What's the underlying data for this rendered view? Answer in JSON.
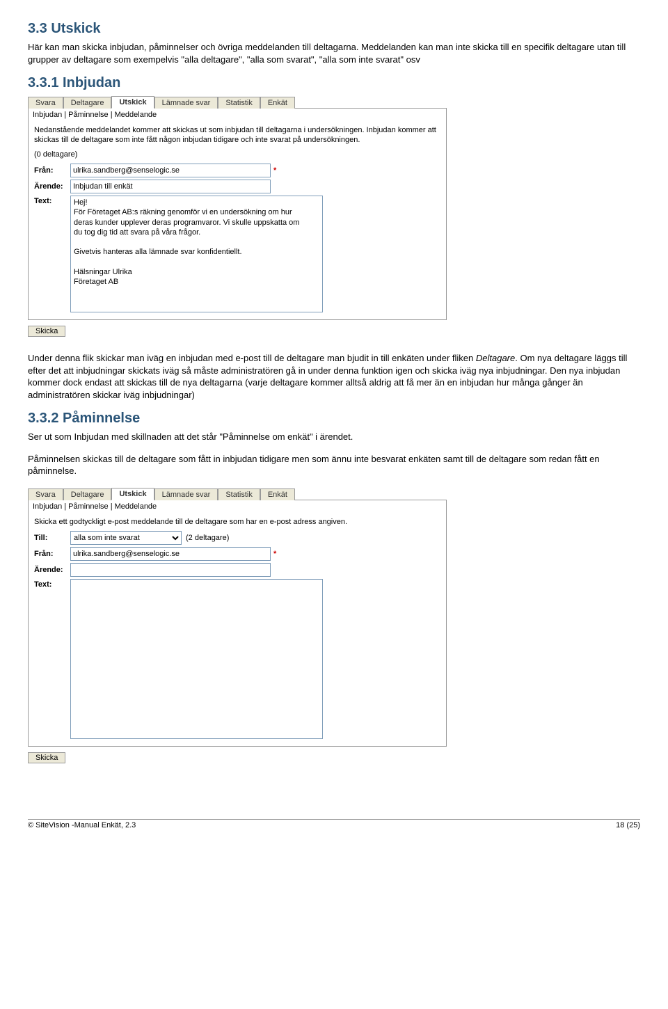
{
  "section1": {
    "title": "3.3 Utskick",
    "para1": "Här kan man skicka inbjudan, påminnelser och övriga meddelanden till deltagarna. Meddelanden kan man inte skicka till en specifik deltagare utan till grupper av deltagare som exempelvis \"alla deltagare\", \"alla som svarat\", \"alla som inte svarat\" osv"
  },
  "section2": {
    "title": "3.3.1 Inbjudan",
    "after": "Under denna flik skickar man iväg en inbjudan med e-post till de deltagare man bjudit in till enkäten under fliken ",
    "after_italic": "Deltagare",
    "after2": ". Om nya deltagare läggs till efter det att inbjudningar skickats iväg så måste administratören gå in under denna funktion igen och skicka iväg nya inbjudningar. Den nya inbjudan kommer dock endast att skickas till de nya deltagarna (varje deltagare kommer alltså aldrig att få mer än en inbjudan hur många gånger än administratören skickar iväg inbjudningar)"
  },
  "section3": {
    "title": "3.3.2 Påminnelse",
    "para1": "Ser ut som Inbjudan med skillnaden att det står \"Påminnelse om enkät\" i ärendet.",
    "para2": "Påminnelsen skickas till de deltagare som fått in inbjudan tidigare men som ännu inte besvarat enkäten samt till de deltagare som redan fått en påminnelse."
  },
  "tabs": [
    "Svara",
    "Deltagare",
    "Utskick",
    "Lämnade svar",
    "Statistik",
    "Enkät"
  ],
  "subtabs": "Inbjudan | Påminnelse | Meddelande",
  "panel1": {
    "info": "Nedanstående meddelandet kommer att skickas ut som inbjudan till deltagarna i undersökningen. Inbjudan kommer att skickas till de deltagare som inte fått någon inbjudan tidigare och inte svarat på undersökningen.",
    "count": "(0 deltagare)",
    "fran_label": "Från:",
    "fran_value": "ulrika.sandberg@senselogic.se",
    "arende_label": "Ärende:",
    "arende_value": "Inbjudan till enkät",
    "text_label": "Text:",
    "textarea": "Hej!\nFör Företaget AB:s räkning genomför vi en undersökning om hur deras kunder upplever deras programvaror. Vi skulle uppskatta om du tog dig tid att svara på våra frågor.\n\nGivetvis hanteras alla lämnade svar konfidentiellt.\n\nHälsningar Ulrika\nFöretaget AB",
    "button": "Skicka"
  },
  "panel2": {
    "info": "Skicka ett godtyckligt e-post meddelande till de deltagare som har en e-post adress angiven.",
    "till_label": "Till:",
    "till_value": "alla som inte svarat",
    "till_after": "(2 deltagare)",
    "fran_label": "Från:",
    "fran_value": "ulrika.sandberg@senselogic.se",
    "arende_label": "Ärende:",
    "arende_value": "",
    "text_label": "Text:",
    "textarea": "",
    "button": "Skicka"
  },
  "footer": {
    "left": "© SiteVision -Manual Enkät, 2.3",
    "right": "18 (25)"
  }
}
